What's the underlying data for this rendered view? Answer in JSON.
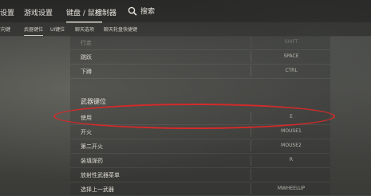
{
  "topnav": {
    "tabs": [
      "游戏设置",
      "游戏设置",
      "键盘 / 鼠标",
      "控制器"
    ],
    "active": "键盘 / 鼠标",
    "search_label": "搜索"
  },
  "subnav": {
    "tabs": [
      "方向键",
      "武器键位",
      "UI键位",
      "聊天选项",
      "聊天轮盘快捷键"
    ]
  },
  "movement_rows": [
    {
      "label": "行走",
      "key": "SHIFT"
    },
    {
      "label": "跳跃",
      "key": "SPACE"
    },
    {
      "label": "下蹲",
      "key": "CTRL"
    }
  ],
  "weapon_section": {
    "title": "武器键位",
    "rows": [
      {
        "label": "使用",
        "key": "E"
      },
      {
        "label": "开火",
        "key": "MOUSE1"
      },
      {
        "label": "第二开火",
        "key": "MOUSE2"
      },
      {
        "label": "装填弹药",
        "key": "R"
      },
      {
        "label": "放射性武器菜单",
        "key": ""
      },
      {
        "label": "选择上一武器",
        "key": "MWHEELUP"
      }
    ]
  },
  "highlight_color": "#d42a2a"
}
